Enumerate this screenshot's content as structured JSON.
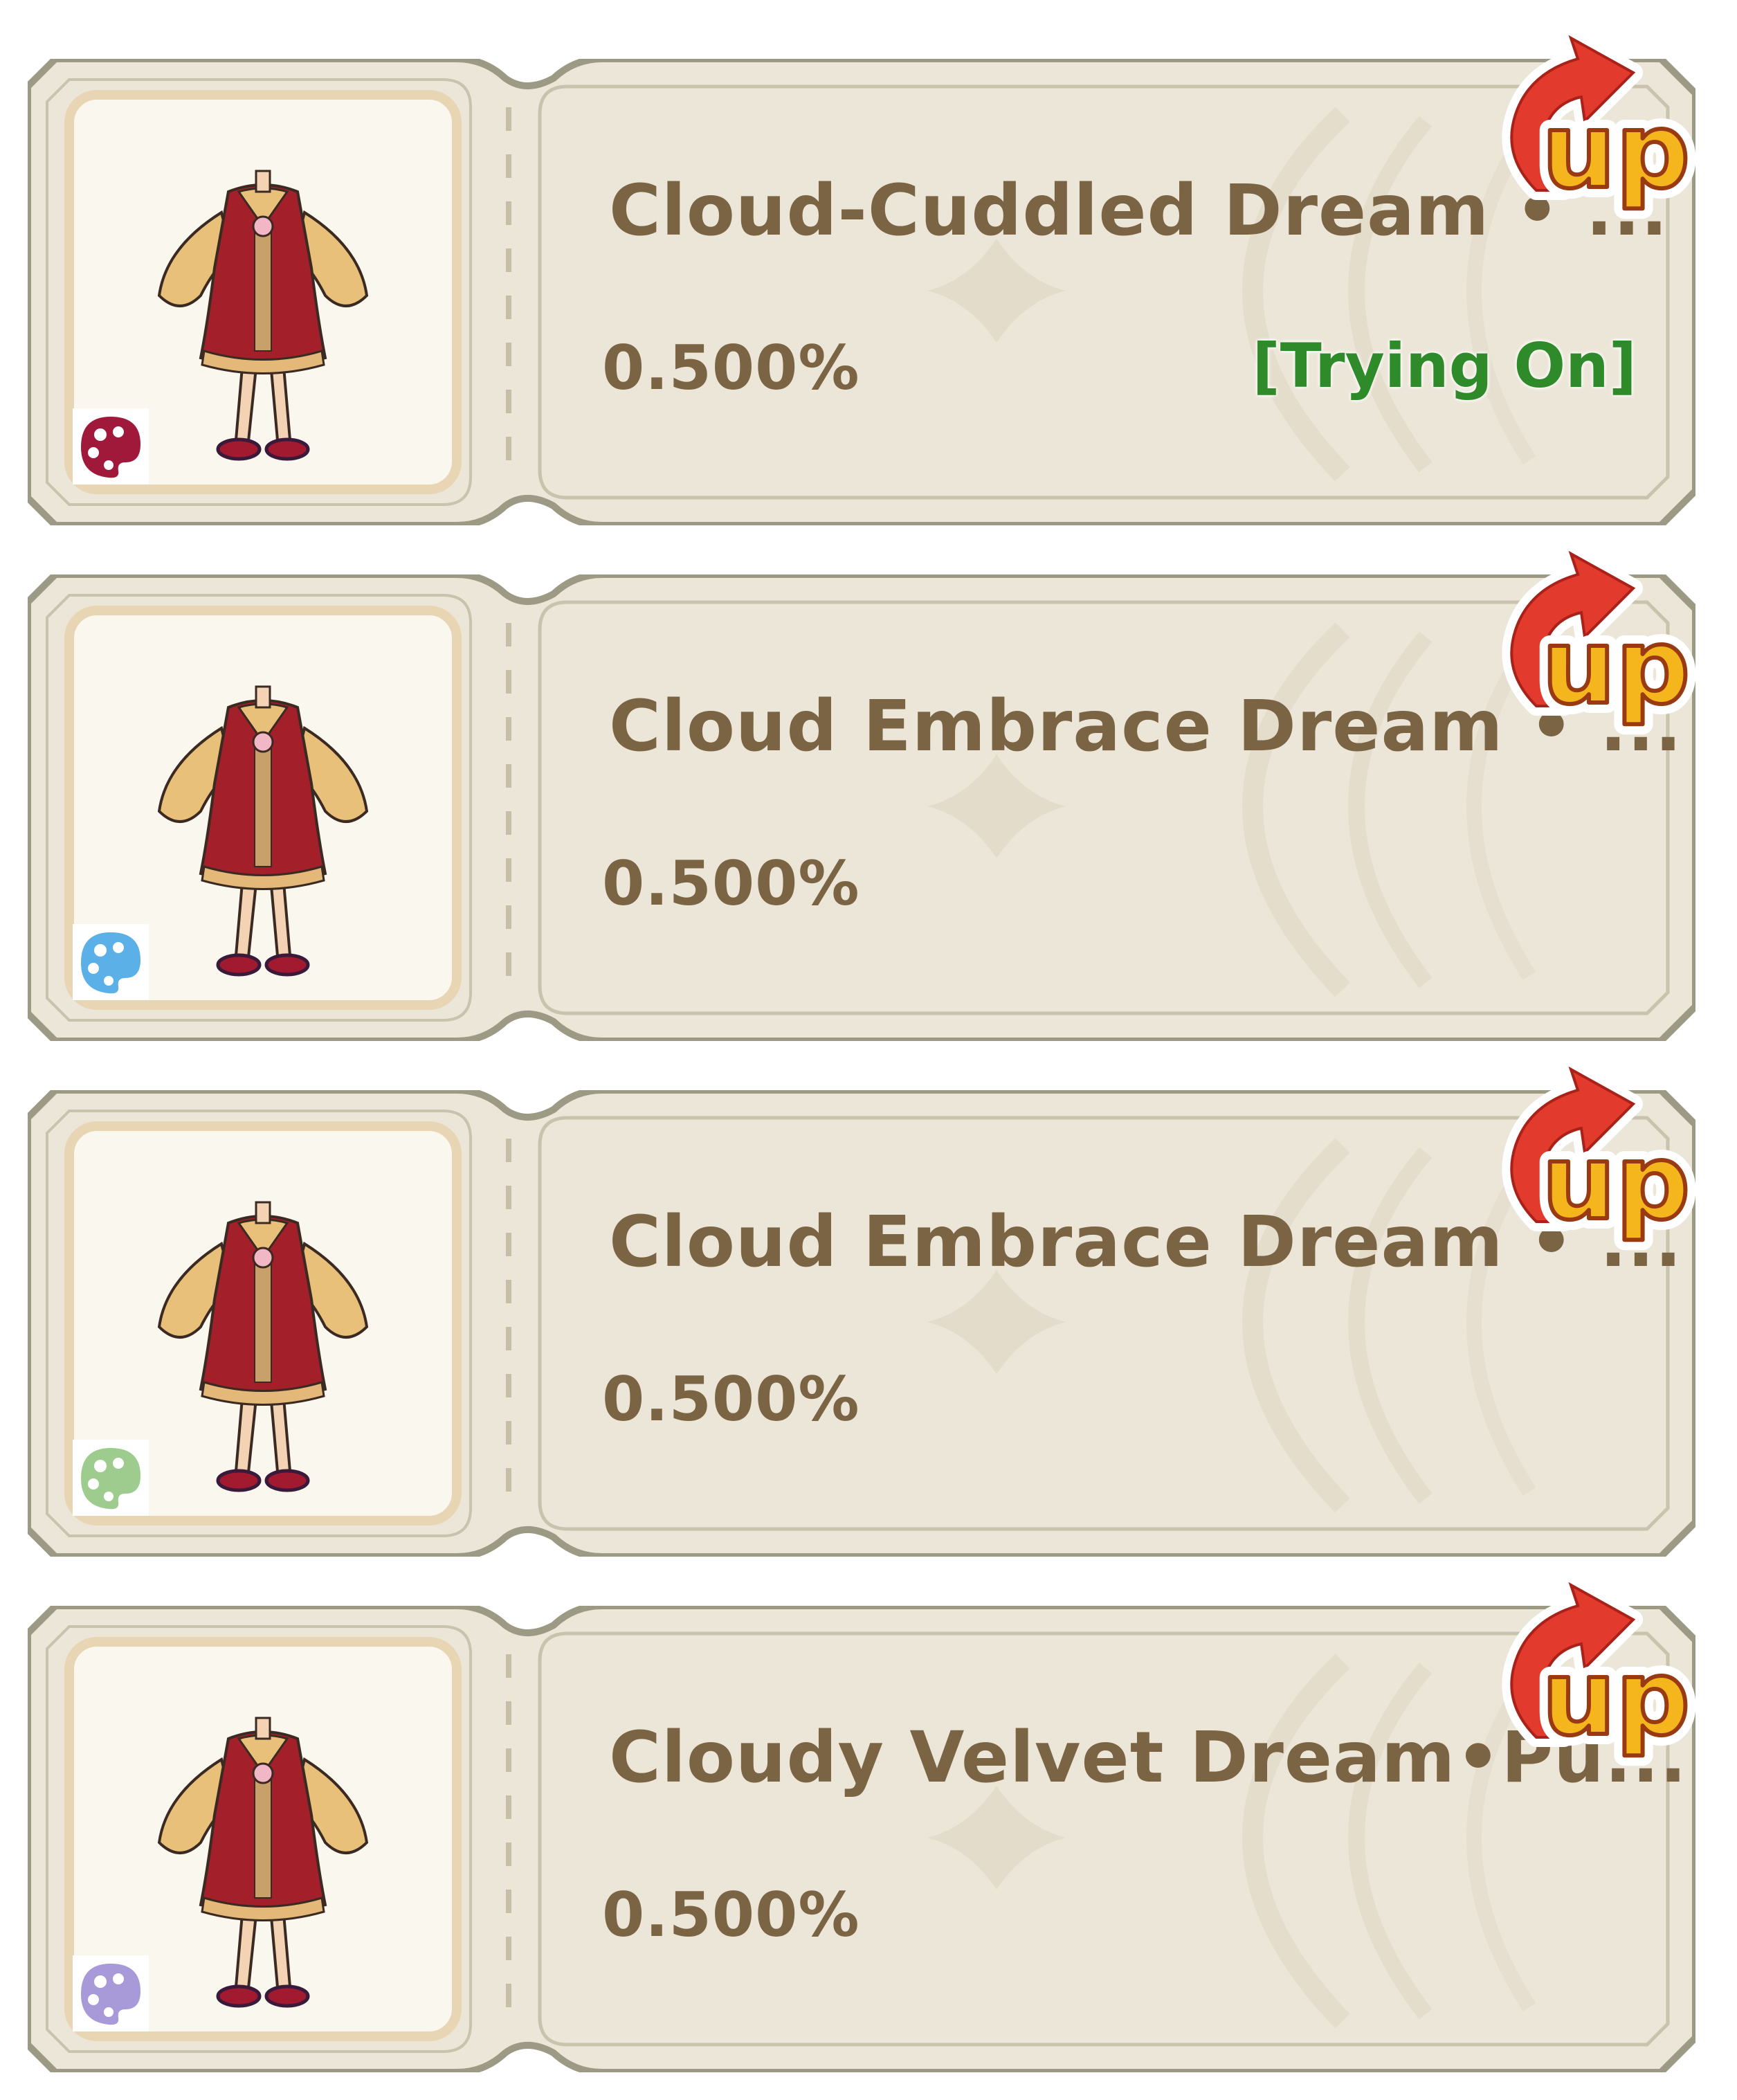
{
  "items": [
    {
      "name": "Cloud-Cuddled Dream • ...",
      "rate": "0.500%",
      "status": "[Trying On]",
      "palette_color": "#a0183a",
      "badge": "up"
    },
    {
      "name": "Cloud Embrace Dream • ...",
      "rate": "0.500%",
      "status": "",
      "palette_color": "#5bb0e8",
      "badge": "up"
    },
    {
      "name": "Cloud Embrace Dream • ...",
      "rate": "0.500%",
      "status": "",
      "palette_color": "#9dcc8e",
      "badge": "up"
    },
    {
      "name": "Cloudy Velvet Dream•Pu...",
      "rate": "0.500%",
      "status": "",
      "palette_color": "#a89ad8",
      "badge": "up"
    }
  ],
  "icons": {
    "outfit": "outfit-icon",
    "palette": "palette-icon",
    "up_badge": "up-arrow-icon"
  },
  "colors": {
    "card_bg": "#ece6d8",
    "card_border": "#9a9a80",
    "text": "#7b6444",
    "status_green": "#2f8a2a",
    "badge_red": "#e23a2c",
    "badge_yellow": "#f5b51c"
  }
}
